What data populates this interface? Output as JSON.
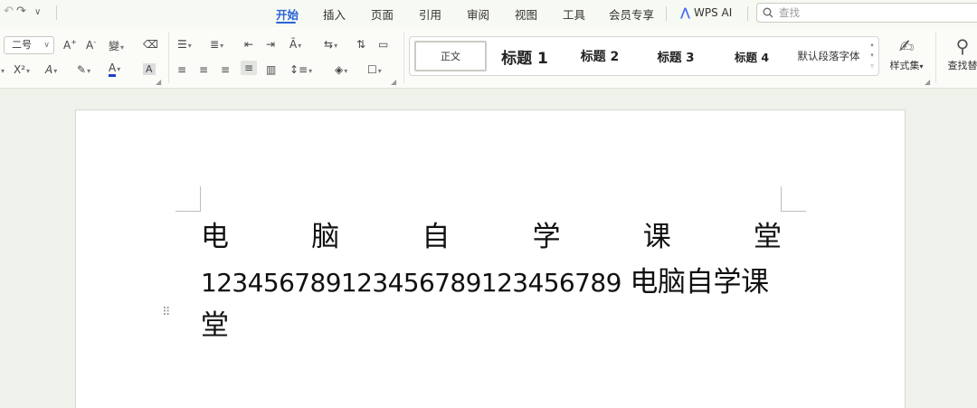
{
  "quick_access": {
    "redo_icon": "redo-icon",
    "more_icon": "chevron-down-icon"
  },
  "tabs": [
    {
      "label": "开始",
      "active": true
    },
    {
      "label": "插入"
    },
    {
      "label": "页面"
    },
    {
      "label": "引用"
    },
    {
      "label": "审阅"
    },
    {
      "label": "视图"
    },
    {
      "label": "工具"
    },
    {
      "label": "会员专享"
    }
  ],
  "wps_ai": {
    "label": "WPS AI"
  },
  "search": {
    "placeholder": "查找"
  },
  "ribbon": {
    "font_size_value": "二号",
    "styles": [
      {
        "label": "正文"
      },
      {
        "label": "标题 1"
      },
      {
        "label": "标题 2"
      },
      {
        "label": "标题 3"
      },
      {
        "label": "标题 4"
      },
      {
        "label": "默认段落字体"
      }
    ],
    "style_set_label": "样式集",
    "find_replace_label": "查找替"
  },
  "document": {
    "line1_chars": [
      "电",
      "脑",
      "自",
      "学",
      "课",
      "堂"
    ],
    "line2_numbers": "123456789123456789123456789",
    "line2_text": " 电脑自学课",
    "line3_text": "堂"
  },
  "colors": {
    "accent": "#2b64d6",
    "font_color_bar": "#1f3fcc",
    "page_background": "#ffffff",
    "workspace_background": "#eef2ea"
  }
}
